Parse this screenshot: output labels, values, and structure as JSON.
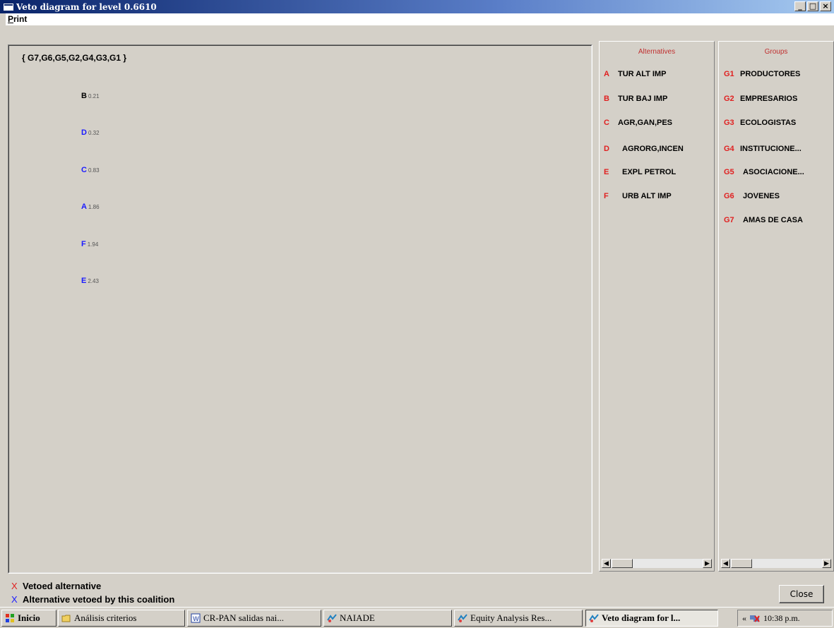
{
  "window": {
    "title": "Veto diagram for level 0.6610",
    "buttons": {
      "minimize": "_",
      "maximize": "□",
      "close": "×"
    }
  },
  "menu": {
    "print": "Print"
  },
  "diagram": {
    "coalition": "{ G7,G6,G5,G2,G4,G3,G1 }",
    "alternatives": [
      {
        "letter": "B",
        "value": "0.21"
      },
      {
        "letter": "D",
        "value": "0.32"
      },
      {
        "letter": "C",
        "value": "0.83"
      },
      {
        "letter": "A",
        "value": "1.86"
      },
      {
        "letter": "F",
        "value": "1.94"
      },
      {
        "letter": "E",
        "value": "2.43"
      }
    ]
  },
  "alternatives_panel": {
    "header": "Alternatives",
    "items": [
      {
        "code": "A",
        "name": "TUR ALT IMP"
      },
      {
        "code": "B",
        "name": "TUR BAJ IMP"
      },
      {
        "code": "C",
        "name": "AGR,GAN,PES"
      },
      {
        "code": "D",
        "name": "AGRORG,INCEN"
      },
      {
        "code": "E",
        "name": "EXPL PETROL"
      },
      {
        "code": "F",
        "name": "URB ALT IMP"
      }
    ]
  },
  "groups_panel": {
    "header": "Groups",
    "items": [
      {
        "code": "G1",
        "name": "PRODUCTORES"
      },
      {
        "code": "G2",
        "name": "EMPRESARIOS"
      },
      {
        "code": "G3",
        "name": "ECOLOGISTAS"
      },
      {
        "code": "G4",
        "name": "INSTITUCIONE..."
      },
      {
        "code": "G5",
        "name": "ASOCIACIONE..."
      },
      {
        "code": "G6",
        "name": "JOVENES"
      },
      {
        "code": "G7",
        "name": "AMAS DE CASA"
      }
    ]
  },
  "legend": {
    "vetoed": {
      "mark": "X",
      "label": "Vetoed alternative"
    },
    "vetoed_by_coalition": {
      "mark": "X",
      "label": "Alternative vetoed by this coalition"
    }
  },
  "close_button": "Close",
  "taskbar": {
    "start": "Inicio",
    "tasks": [
      {
        "label": "Análisis criterios"
      },
      {
        "label": "CR-PAN salidas nai..."
      },
      {
        "label": "NAIADE"
      },
      {
        "label": "Equity Analysis Res..."
      },
      {
        "label": "Veto diagram for l..."
      }
    ],
    "tray_arrows": "«",
    "clock": "10:38 p.m."
  },
  "colors": {
    "red_marker": "#e02020",
    "blue_marker": "#1a1aff",
    "titlebar": "#0a246a"
  }
}
